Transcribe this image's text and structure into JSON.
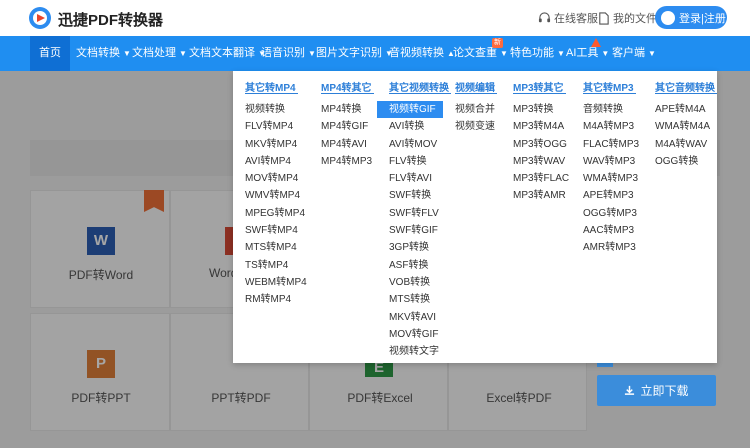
{
  "header": {
    "brand": "迅捷PDF转换器",
    "online_service": "在线客服",
    "my_files": "我的文件",
    "login": "登录|注册"
  },
  "nav": {
    "items": [
      {
        "label": "首页",
        "has_arrow": false
      },
      {
        "label": "文档转换",
        "arrow": "▼"
      },
      {
        "label": "文档处理",
        "arrow": "▼"
      },
      {
        "label": "文档文本翻译",
        "arrow": "▼"
      },
      {
        "label": "语音识别",
        "arrow": "▼"
      },
      {
        "label": "图片文字识别",
        "arrow": "▼"
      },
      {
        "label": "音视频转换",
        "arrow": "▲"
      },
      {
        "label": "论文查重",
        "arrow": "▼",
        "badge": "新"
      },
      {
        "label": "特色功能",
        "arrow": "▼"
      },
      {
        "label": "AI工具",
        "arrow": "▼"
      },
      {
        "label": "客户端",
        "arrow": "▼"
      }
    ]
  },
  "dropdown": {
    "columns": [
      {
        "title": "其它转MP4",
        "items": [
          "视频转换",
          "FLV转MP4",
          "MKV转MP4",
          "AVI转MP4",
          "MOV转MP4",
          "WMV转MP4",
          "MPEG转MP4",
          "SWF转MP4",
          "MTS转MP4",
          "TS转MP4",
          "WEBM转MP4",
          "RM转MP4"
        ]
      },
      {
        "title": "MP4转其它",
        "items": [
          "MP4转换",
          "MP4转GIF",
          "MP4转AVI",
          "MP4转MP3"
        ]
      },
      {
        "title": "其它视频转换",
        "items": [
          "视频转GIF",
          "AVI转换",
          "AVI转MOV",
          "FLV转换",
          "FLV转AVI",
          "SWF转换",
          "SWF转FLV",
          "SWF转GIF",
          "3GP转换",
          "ASF转换",
          "VOB转换",
          "MTS转换",
          "MKV转AVI",
          "MOV转GIF",
          "视频转文字"
        ],
        "selected_index": 0
      },
      {
        "title": "视频编辑",
        "items": [
          "视频合并",
          "视频变速"
        ]
      },
      {
        "title": "MP3转其它",
        "items": [
          "MP3转换",
          "MP3转M4A",
          "MP3转OGG",
          "MP3转WAV",
          "MP3转FLAC",
          "MP3转AMR"
        ]
      },
      {
        "title": "其它转MP3",
        "items": [
          "音频转换",
          "M4A转MP3",
          "FLAC转MP3",
          "WAV转MP3",
          "WMA转MP3",
          "APE转MP3",
          "OGG转MP3",
          "AAC转MP3",
          "AMR转MP3"
        ]
      },
      {
        "title": "其它音频转换",
        "items": [
          "APE转M4A",
          "WMA转M4A",
          "M4A转WAV",
          "OGG转换"
        ]
      }
    ]
  },
  "cards": [
    {
      "label": "PDF转Word",
      "icon": "W",
      "color": "#2b5fb4"
    },
    {
      "label": "Word",
      "icon": "",
      "color": "#d84a36"
    },
    {
      "label": "PDF转PPT",
      "icon": "P",
      "color": "#e0803a"
    },
    {
      "label": "PPT转PDF",
      "icon": "",
      "color": "#d84a36"
    },
    {
      "label": "PDF转Excel",
      "icon": "E",
      "color": "#2e9a48"
    },
    {
      "label": "Excel转PDF",
      "icon": "",
      "color": "#d84a36"
    }
  ],
  "download": {
    "label": "立即下载"
  },
  "colors": {
    "nav_bg": "#1f8ef1",
    "nav_active": "#0f6fd4",
    "accent": "#2d8cf0"
  }
}
